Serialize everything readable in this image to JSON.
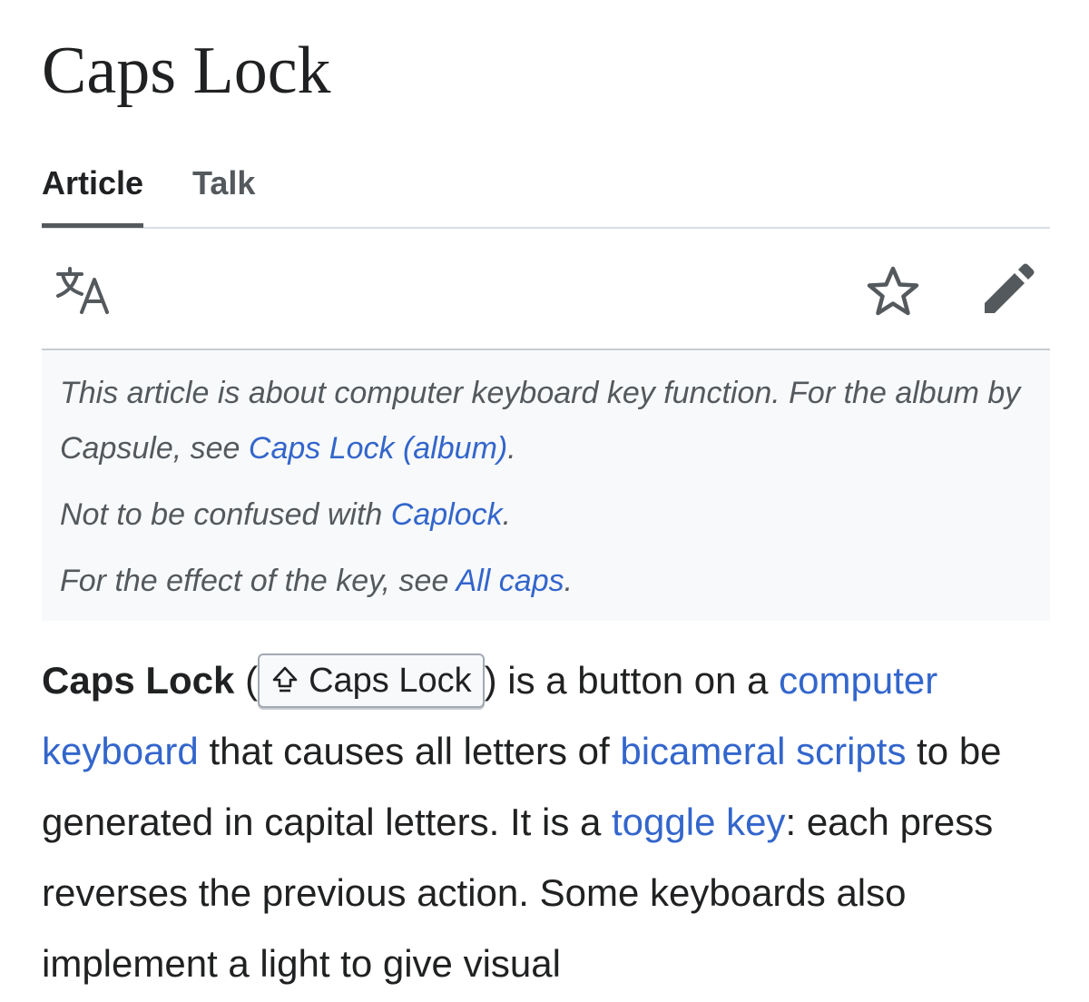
{
  "page": {
    "title": "Caps Lock"
  },
  "tabs": [
    {
      "label": "Article",
      "active": true
    },
    {
      "label": "Talk",
      "active": false
    }
  ],
  "toolbar": {
    "icons": [
      "language-icon",
      "star-icon",
      "edit-pencil-icon"
    ]
  },
  "hatnotes": {
    "line1": {
      "text": "This article is about computer keyboard key function. For the album by Capsule, see ",
      "link": "Caps Lock (album)",
      "end": "."
    },
    "line2": {
      "text": "Not to be confused with ",
      "link": "Caplock",
      "end": "."
    },
    "line3": {
      "text": "For the effect of the key, see ",
      "link": "All caps",
      "end": "."
    }
  },
  "body": {
    "term": "Caps Lock",
    "open_paren": " (",
    "kbd_label": "Caps Lock",
    "t1": ") is a button on a ",
    "link1": "computer keyboard",
    "t2": " that causes all letters of ",
    "link2": "bicameral scripts",
    "t3": " to be generated in capital letters. It is a ",
    "link3": "toggle key",
    "t4": ": each press reverses the previous action. Some keyboards also implement a light to give visual"
  },
  "colors": {
    "link": "#3366cc",
    "text": "#202122",
    "muted": "#54595d",
    "hatnote_bg": "#f8f9fa"
  }
}
